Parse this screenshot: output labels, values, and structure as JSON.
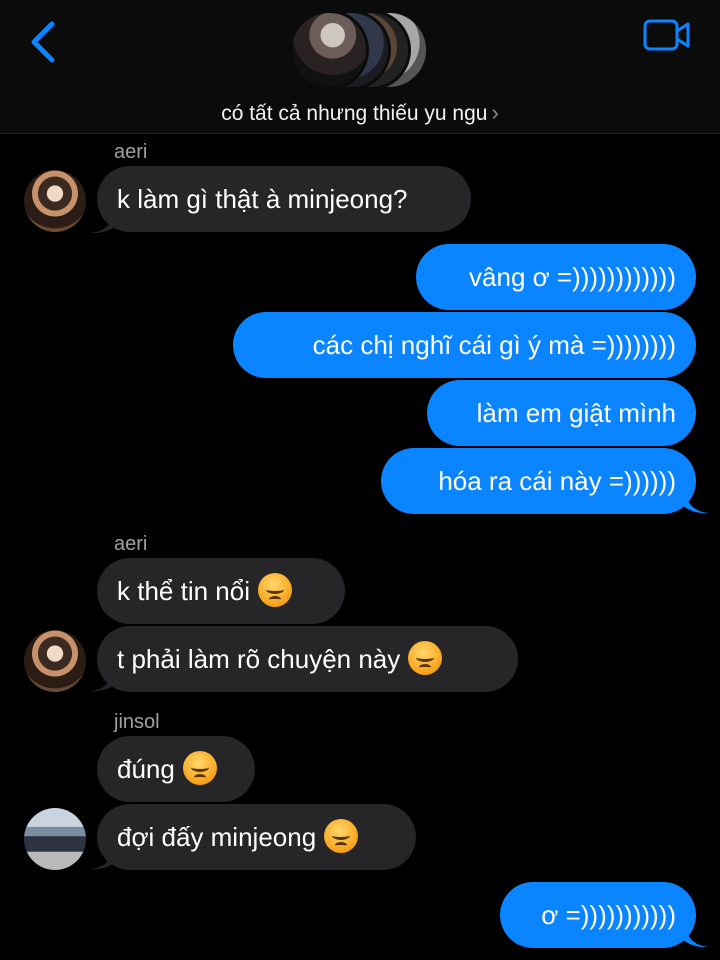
{
  "header": {
    "group_name": "có tất cả nhưng thiếu yu ngu",
    "chevron": "›",
    "back_icon": "chevron-left-icon",
    "video_icon": "video-camera-icon",
    "accent_color": "#0a84ff"
  },
  "messages": [
    {
      "sender": "aeri",
      "text": "k làm gì thật à minjeong?",
      "direction": "incoming"
    },
    {
      "text": "vâng ơ =))))))))))))",
      "direction": "outgoing"
    },
    {
      "text": "các chị nghĩ cái gì ý mà =))))))))",
      "direction": "outgoing"
    },
    {
      "text": "làm em giật mình",
      "direction": "outgoing"
    },
    {
      "text": "hóa ra cái này =))))))",
      "direction": "outgoing"
    },
    {
      "sender": "aeri",
      "text": "k thể tin nổi",
      "emoji": "angry-face-icon",
      "direction": "incoming"
    },
    {
      "text": "t phải làm rõ chuyện này",
      "emoji": "angry-face-icon",
      "direction": "incoming"
    },
    {
      "sender": "jinsol",
      "text": "đúng",
      "emoji": "angry-face-icon",
      "direction": "incoming"
    },
    {
      "text": "đợi đấy minjeong",
      "emoji": "angry-face-icon",
      "direction": "incoming"
    },
    {
      "text": "ơ =)))))))))))",
      "direction": "outgoing"
    }
  ]
}
